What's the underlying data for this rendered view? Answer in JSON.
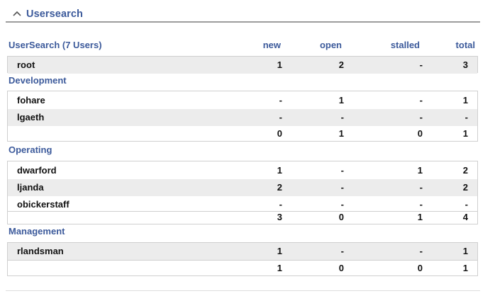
{
  "panel": {
    "title": "Usersearch"
  },
  "table": {
    "title": "UserSearch (7 Users)",
    "columns": {
      "new": "new",
      "open": "open",
      "stalled": "stalled",
      "total": "total"
    },
    "top_rows": [
      {
        "name": "root",
        "new": "1",
        "open": "2",
        "stalled": "-",
        "total": "3"
      }
    ],
    "groups": [
      {
        "title": "Development",
        "rows": [
          {
            "name": "fohare",
            "new": "-",
            "open": "1",
            "stalled": "-",
            "total": "1"
          },
          {
            "name": "lgaeth",
            "new": "-",
            "open": "-",
            "stalled": "-",
            "total": "-"
          }
        ],
        "sum": {
          "new": "0",
          "open": "1",
          "stalled": "0",
          "total": "1"
        }
      },
      {
        "title": "Operating",
        "rows": [
          {
            "name": "dwarford",
            "new": "1",
            "open": "-",
            "stalled": "1",
            "total": "2"
          },
          {
            "name": "ljanda",
            "new": "2",
            "open": "-",
            "stalled": "-",
            "total": "2"
          },
          {
            "name": "obickerstaff",
            "new": "-",
            "open": "-",
            "stalled": "-",
            "total": "-"
          }
        ],
        "sum": {
          "new": "3",
          "open": "0",
          "stalled": "1",
          "total": "4"
        }
      },
      {
        "title": "Management",
        "rows": [
          {
            "name": "rlandsman",
            "new": "1",
            "open": "-",
            "stalled": "-",
            "total": "1"
          }
        ],
        "sum": {
          "new": "1",
          "open": "0",
          "stalled": "0",
          "total": "1"
        }
      }
    ]
  },
  "colors": {
    "accent": "#3c5a9b",
    "row_shade": "#ececec",
    "border": "#cfcfcf"
  },
  "icons": {
    "collapse": "chevron-up-icon"
  }
}
